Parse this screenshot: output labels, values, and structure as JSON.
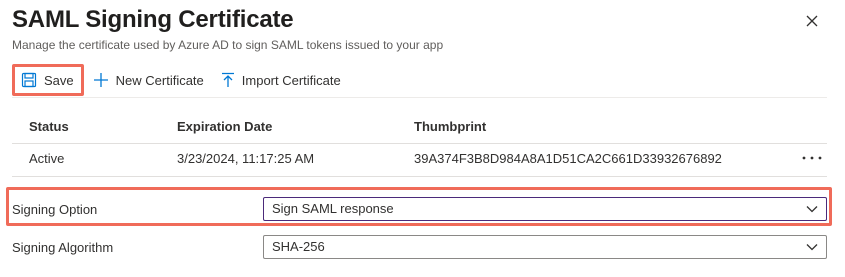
{
  "header": {
    "title": "SAML Signing Certificate",
    "subtitle": "Manage the certificate used by Azure AD to sign SAML tokens issued to your app",
    "close_icon": "close-icon"
  },
  "toolbar": {
    "save_label": "Save",
    "new_cert_label": "New Certificate",
    "import_cert_label": "Import Certificate"
  },
  "table": {
    "columns": [
      "Status",
      "Expiration Date",
      "Thumbprint"
    ],
    "rows": [
      {
        "status": "Active",
        "expiration": "3/23/2024, 11:17:25 AM",
        "thumbprint": "39A374F3B8D984A8A1D51CA2C661D33932676892"
      }
    ]
  },
  "form": {
    "signing_option": {
      "label": "Signing Option",
      "value": "Sign SAML response"
    },
    "signing_algorithm": {
      "label": "Signing Algorithm",
      "value": "SHA-256"
    }
  },
  "colors": {
    "highlight": "#f06b59",
    "accent": "#0078d4",
    "select_focus_border": "#4b2a7a"
  }
}
